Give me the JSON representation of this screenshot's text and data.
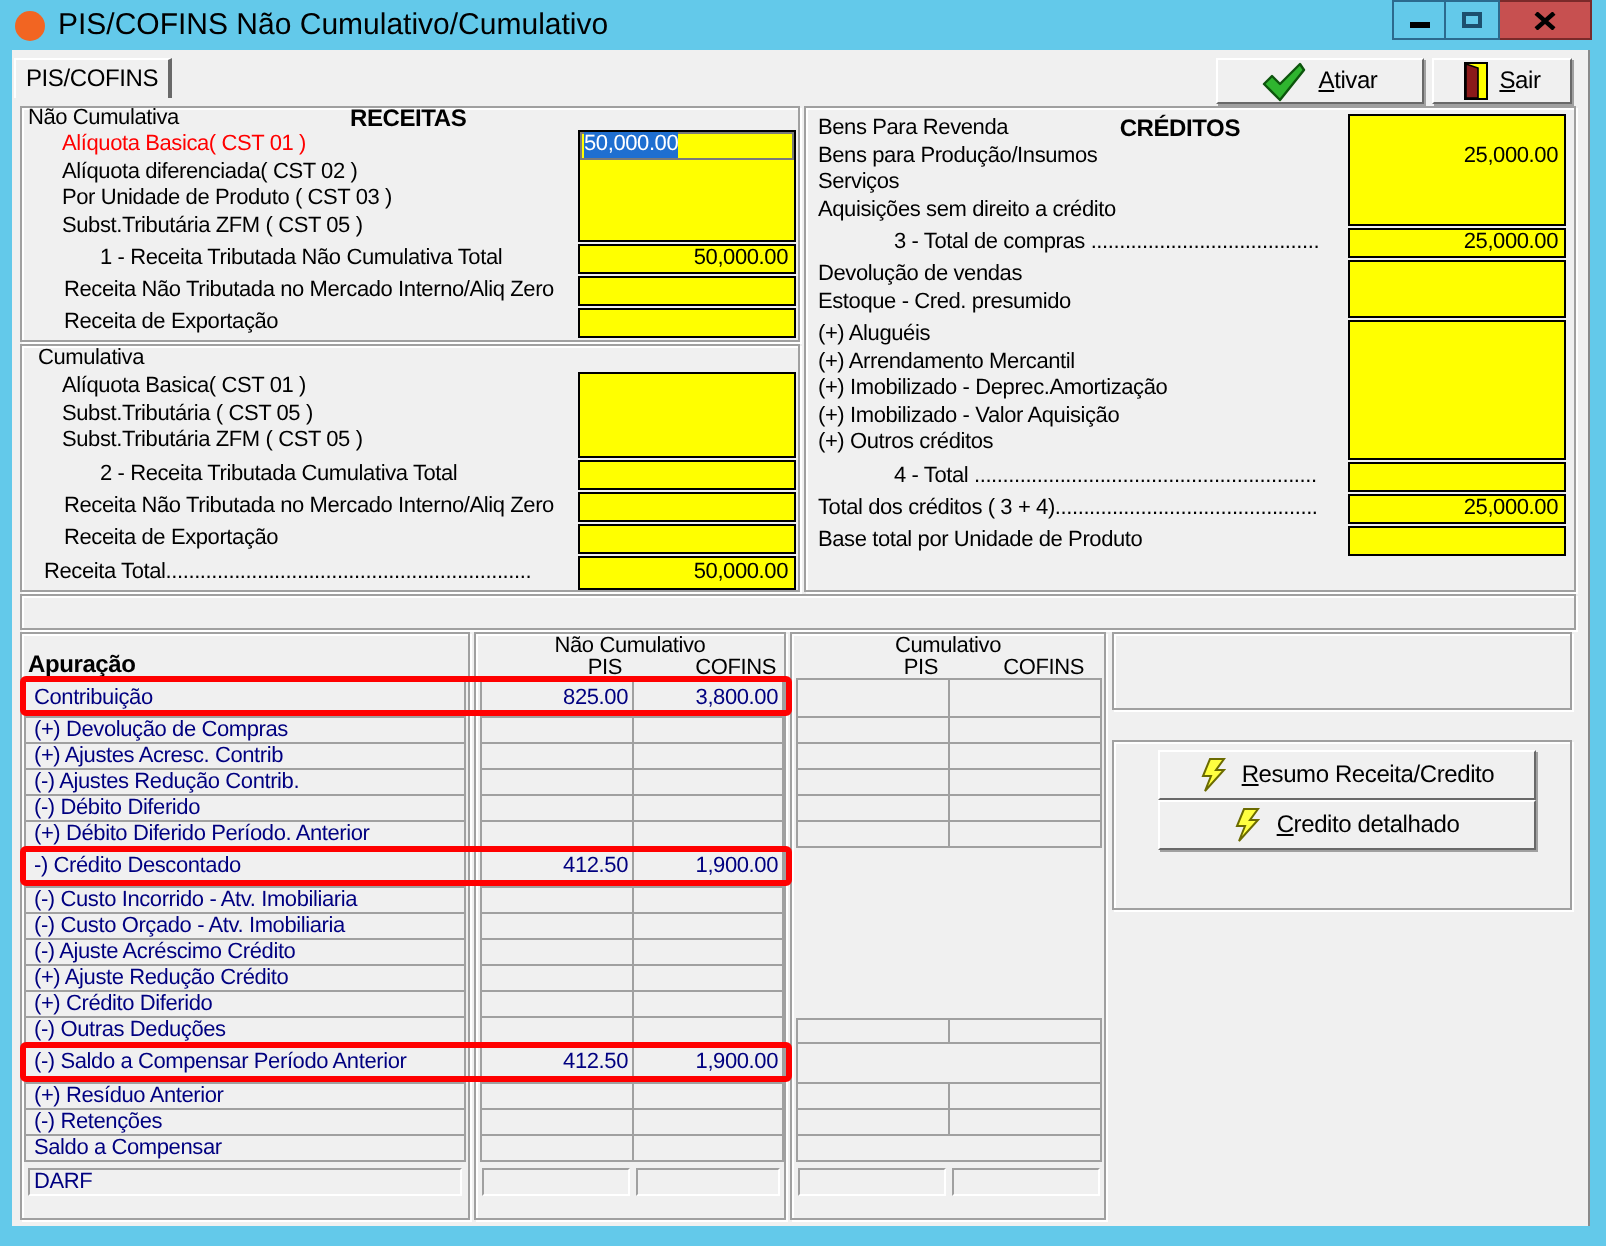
{
  "window": {
    "title": "PIS/COFINS Não Cumulativo/Cumulativo"
  },
  "tabs": [
    {
      "label": "PIS/COFINS",
      "selected": true
    }
  ],
  "toolbar": [
    {
      "kind": "confirm",
      "label": "Ativar",
      "mnemonic": true
    },
    {
      "kind": "exit",
      "label": "Sair",
      "mnemonic": true
    }
  ],
  "receitas": {
    "title": "RECEITAS",
    "sections": [
      {
        "caption": "Não Cumulativa",
        "blocks": [
          {
            "kind": "grid",
            "rows": [
              {
                "label": "Alíquota Basica( CST 01 )",
                "active": true,
                "value": "50,000.00",
                "text_selected": true
              },
              {
                "label": "Alíquota diferenciada( CST 02 )",
                "active": false
              },
              {
                "label": "Por Unidade de Produto ( CST 03 )",
                "active": false
              },
              {
                "label": "Subst.Tributária ZFM ( CST 05 )",
                "active": false
              }
            ]
          },
          {
            "kind": "subtotal",
            "label": "1 - Receita Tributada Não Cumulativa Total",
            "value": "50,000.00"
          },
          {
            "kind": "field",
            "label": "Receita Não Tributada no Mercado Interno/Aliq Zero"
          },
          {
            "kind": "field",
            "label": "Receita de Exportação"
          }
        ]
      },
      {
        "caption": "Cumulativa",
        "blocks": [
          {
            "kind": "grid",
            "rows": [
              {
                "label": "Alíquota Basica( CST 01 )",
                "active": false
              },
              {
                "label": "Subst.Tributária ( CST 05 )",
                "active": false
              },
              {
                "label": "Subst.Tributária ZFM ( CST 05 )",
                "active": false
              }
            ]
          },
          {
            "kind": "subtotal",
            "label": "2 - Receita Tributada Cumulativa Total"
          },
          {
            "kind": "field",
            "label": "Receita Não Tributada no Mercado Interno/Aliq Zero"
          },
          {
            "kind": "field",
            "label": "Receita de Exportação"
          },
          {
            "kind": "total",
            "label": "Receita Total................................................................",
            "value": "50,000.00"
          }
        ]
      }
    ]
  },
  "creditos": {
    "title": "CRÉDITOS",
    "blocks": [
      {
        "kind": "grid",
        "rows": [
          {
            "label": "Bens Para Revenda"
          },
          {
            "label": "Bens para Produção/Insumos",
            "value": "25,000.00"
          },
          {
            "label": "Serviços"
          },
          {
            "label": "Aquisições sem direito a crédito"
          }
        ]
      },
      {
        "kind": "subtotal",
        "label": "3 - Total de compras ........................................",
        "value": "25,000.00"
      },
      {
        "kind": "grid",
        "rows": [
          {
            "label": "Devolução de vendas"
          },
          {
            "label": "Estoque - Cred. presumido"
          }
        ]
      },
      {
        "kind": "grid",
        "rows": [
          {
            "label": "(+) Aluguéis"
          },
          {
            "label": "(+) Arrendamento Mercantil"
          },
          {
            "label": "(+) Imobilizado - Deprec.Amortização"
          },
          {
            "label": "(+) Imobilizado - Valor Aquisição"
          },
          {
            "label": "(+) Outros créditos"
          }
        ]
      },
      {
        "kind": "subtotal",
        "label": "4 - Total ............................................................"
      },
      {
        "kind": "field",
        "label": "Total dos créditos ( 3 + 4)..............................................",
        "value": "25,000.00"
      },
      {
        "kind": "field",
        "label": "Base total por Unidade de Produto"
      }
    ]
  },
  "apuracao": {
    "title": "Apuração",
    "nao_cumulativo": {
      "caption": "Não Cumulativo",
      "columns": [
        "PIS",
        "COFINS"
      ]
    },
    "cumulativo": {
      "caption": "Cumulativo",
      "columns": [
        "PIS",
        "COFINS"
      ]
    },
    "rows": [
      {
        "label": "Contribuição",
        "pis": "825.00",
        "cofins": "3,800.00",
        "highlighted": true
      },
      {
        "label": "(+) Devolução de Compras",
        "highlighted": false
      },
      {
        "label": "(+) Ajustes Acresc. Contrib",
        "highlighted": false
      },
      {
        "label": "(-) Ajustes Redução Contrib.",
        "highlighted": false
      },
      {
        "label": "(-) Débito Diferido",
        "highlighted": false
      },
      {
        "label": "(+) Débito Diferido Período. Anterior",
        "highlighted": false
      },
      {
        "label": "-) Crédito Descontado",
        "pis": "412.50",
        "cofins": "1,900.00",
        "highlighted": true
      },
      {
        "label": "(-) Custo Incorrido - Atv. Imobiliaria",
        "highlighted": false
      },
      {
        "label": "(-) Custo Orçado - Atv. Imobiliaria",
        "highlighted": false
      },
      {
        "label": "(-) Ajuste Acréscimo Crédito",
        "highlighted": false
      },
      {
        "label": "(+) Ajuste Redução Crédito",
        "highlighted": false
      },
      {
        "label": "(+) Crédito Diferido",
        "highlighted": false
      },
      {
        "label": "(-) Outras Deduções",
        "highlighted": false
      },
      {
        "label": "(-) Saldo a Compensar Período Anterior",
        "pis": "412.50",
        "cofins": "1,900.00",
        "highlighted": true
      },
      {
        "label": "(+) Resíduo Anterior",
        "highlighted": false
      },
      {
        "label": "(-) Retenções",
        "highlighted": false
      },
      {
        "label": "Saldo a Compensar",
        "highlighted": false
      }
    ],
    "darf": "DARF"
  },
  "actions": [
    {
      "label": "Resumo Receita/Credito",
      "mnemonic": true
    },
    {
      "label": "Credito detalhado",
      "mnemonic": true
    }
  ]
}
